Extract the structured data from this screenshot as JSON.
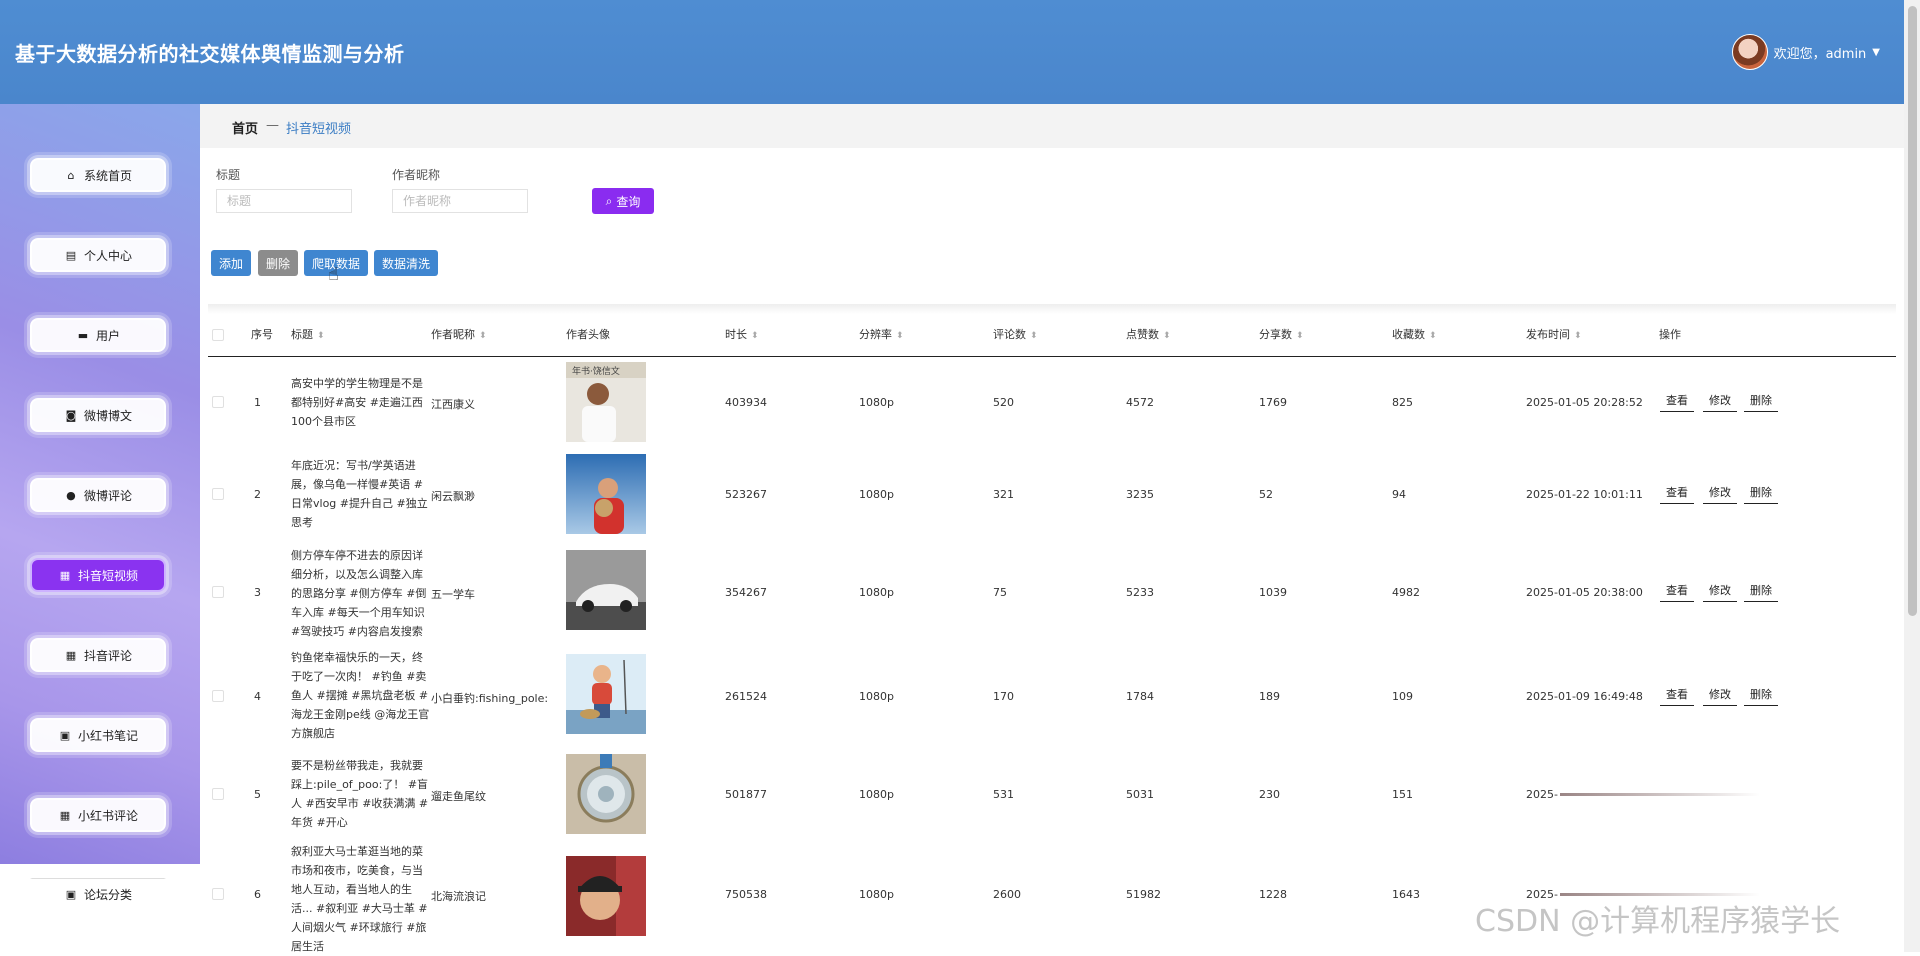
{
  "app": {
    "title": "基于大数据分析的社交媒体舆情监测与分析"
  },
  "user": {
    "greeting": "欢迎您，admin"
  },
  "sidebar": {
    "items": [
      {
        "label": "系统首页",
        "icon": "home-icon"
      },
      {
        "label": "个人中心",
        "icon": "profile-icon"
      },
      {
        "label": "用户",
        "icon": "monitor-icon"
      },
      {
        "label": "微博博文",
        "icon": "ticket-icon"
      },
      {
        "label": "微博评论",
        "icon": "person-icon"
      },
      {
        "label": "抖音短视频",
        "icon": "grid-icon",
        "active": true
      },
      {
        "label": "抖音评论",
        "icon": "grid-icon"
      },
      {
        "label": "小红书笔记",
        "icon": "clipboard-icon"
      },
      {
        "label": "小红书评论",
        "icon": "grid-icon"
      },
      {
        "label": "论坛分类",
        "icon": "clipboard-icon"
      }
    ]
  },
  "breadcrumb": {
    "home": "首页",
    "separator": "—",
    "current": "抖音短视频"
  },
  "filters": {
    "title_label": "标题",
    "title_placeholder": "标题",
    "author_label": "作者昵称",
    "author_placeholder": "作者昵称",
    "search_label": "查询"
  },
  "toolbar": {
    "add": "添加",
    "delete": "删除",
    "crawl": "爬取数据",
    "clean": "数据清洗"
  },
  "table": {
    "headers": {
      "index": "序号",
      "title": "标题",
      "author": "作者昵称",
      "avatar": "作者头像",
      "duration": "时长",
      "resolution": "分辨率",
      "comments": "评论数",
      "likes": "点赞数",
      "shares": "分享数",
      "favorites": "收藏数",
      "publish_time": "发布时间",
      "actions": "操作"
    },
    "action_labels": {
      "view": "查看",
      "edit": "修改",
      "delete": "删除"
    },
    "rows": [
      {
        "index": "1",
        "title": "高安中学的学生物理是不是都特别好#高安 #走遍江西100个县市区",
        "author": "江西康义",
        "duration": "403934",
        "resolution": "1080p",
        "comments": "520",
        "likes": "4572",
        "shares": "1769",
        "favorites": "825",
        "publish_time": "2025-01-05 20:28:52"
      },
      {
        "index": "2",
        "title": "年底近况：写书/学英语进展，像乌龟一样慢#英语 #日常vlog #提升自己 #独立思考",
        "author": "闲云飘渺",
        "duration": "523267",
        "resolution": "1080p",
        "comments": "321",
        "likes": "3235",
        "shares": "52",
        "favorites": "94",
        "publish_time": "2025-01-22 10:01:11"
      },
      {
        "index": "3",
        "title": "侧方停车停不进去的原因详细分析，以及怎么调整入库的思路分享 #侧方停车 #倒车入库 #每天一个用车知识 #驾驶技巧 #内容启发搜索",
        "author": "五一学车",
        "duration": "354267",
        "resolution": "1080p",
        "comments": "75",
        "likes": "5233",
        "shares": "1039",
        "favorites": "4982",
        "publish_time": "2025-01-05 20:38:00"
      },
      {
        "index": "4",
        "title": "钓鱼佬幸福快乐的一天，终于吃了一次肉！ #钓鱼 #卖鱼人 #摆摊 #黑坑盘老板 #海龙王金刚pe线 @海龙王官方旗舰店",
        "author": "小白垂钓:fishing_pole:",
        "duration": "261524",
        "resolution": "1080p",
        "comments": "170",
        "likes": "1784",
        "shares": "189",
        "favorites": "109",
        "publish_time": "2025-01-09 16:49:48"
      },
      {
        "index": "5",
        "title": "要不是粉丝带我走，我就要踩上:pile_of_poo:了！ #盲人 #西安早市 #收获满满 #年货 #开心",
        "author": "遛走鱼尾纹",
        "duration": "501877",
        "resolution": "1080p",
        "comments": "531",
        "likes": "5031",
        "shares": "230",
        "favorites": "151",
        "publish_time": "2025-"
      },
      {
        "index": "6",
        "title": "叙利亚大马士革逛当地的菜市场和夜市，吃美食，与当地人互动，看当地人的生活... #叙利亚 #大马士革 #人间烟火气 #环球旅行 #旅居生活",
        "author": "北海流浪记",
        "duration": "750538",
        "resolution": "1080p",
        "comments": "2600",
        "likes": "51982",
        "shares": "1228",
        "favorites": "1643",
        "publish_time": "2025-"
      }
    ]
  },
  "watermark": "CSDN @计算机程序猿学长"
}
